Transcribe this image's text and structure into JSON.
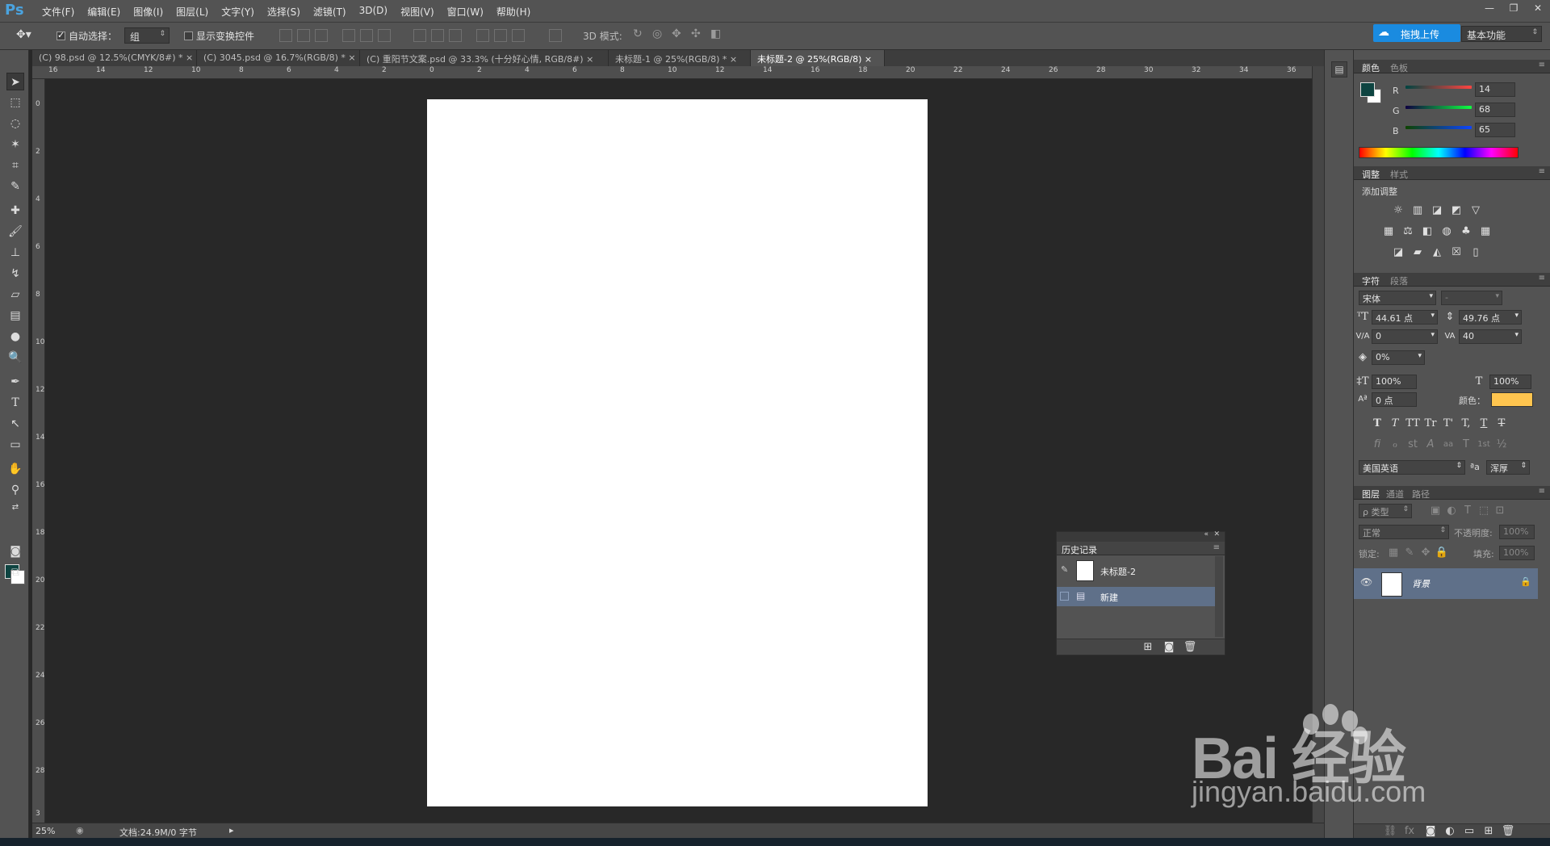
{
  "app": {
    "logo": "Ps"
  },
  "menu": [
    "文件(F)",
    "编辑(E)",
    "图像(I)",
    "图层(L)",
    "文字(Y)",
    "选择(S)",
    "滤镜(T)",
    "3D(D)",
    "视图(V)",
    "窗口(W)",
    "帮助(H)"
  ],
  "window_controls": [
    "—",
    "❐",
    "✕"
  ],
  "options": {
    "auto_select_label": "自动选择：",
    "auto_select_value": "组",
    "show_transform_label": "显示变换控件",
    "mode_3d_label": "3D 模式:",
    "upload_label": "拖拽上传",
    "workspace": "基本功能"
  },
  "doc_tabs": [
    {
      "label": "(C) 98.psd @ 12.5%(CMYK/8#) *",
      "close": "×"
    },
    {
      "label": "(C) 3045.psd @ 16.7%(RGB/8) *",
      "close": "×"
    },
    {
      "label": "(C) 重阳节文案.psd @ 33.3% (十分好心情, RGB/8#)",
      "close": "×"
    },
    {
      "label": "未标题-1 @ 25%(RGB/8) *",
      "close": "×"
    },
    {
      "label": "未标题-2 @ 25%(RGB/8)",
      "close": "×"
    }
  ],
  "ruler_h": [
    "16",
    "14",
    "12",
    "10",
    "8",
    "6",
    "4",
    "2",
    "0",
    "2",
    "4",
    "6",
    "8",
    "10",
    "12",
    "14",
    "16",
    "18",
    "20",
    "22",
    "24",
    "26",
    "28",
    "30",
    "32",
    "34",
    "36"
  ],
  "ruler_v": [
    "0",
    "2",
    "4",
    "6",
    "8",
    "10",
    "12",
    "14",
    "16",
    "18",
    "20",
    "22",
    "24",
    "26",
    "28",
    "3"
  ],
  "status": {
    "zoom": "25%",
    "doc_info": "文档:24.9M/0 字节"
  },
  "color_panel": {
    "tabs": [
      "颜色",
      "色板"
    ],
    "r_label": "R",
    "g_label": "G",
    "b_label": "B",
    "r": "14",
    "g": "68",
    "b": "65",
    "fg": "#0e4441",
    "bg": "#ffffff"
  },
  "adjust_panel": {
    "tabs": [
      "调整",
      "样式"
    ],
    "title": "添加调整"
  },
  "char_panel": {
    "tabs": [
      "字符",
      "段落"
    ],
    "font": "宋体",
    "style": "-",
    "size": "44.61 点",
    "leading": "49.76 点",
    "kerning": "0",
    "tracking": "40",
    "tsume": "0%",
    "v_scale": "100%",
    "h_scale": "100%",
    "baseline": "0 点",
    "color_label": "颜色：",
    "color": "#ffc54f",
    "language": "美国英语",
    "aa_label": "ªa",
    "antialias": "浑厚",
    "style_buttons": [
      "T",
      "T",
      "TT",
      "Tr",
      "T'",
      "T,",
      "T",
      "T"
    ],
    "ot_buttons": [
      "fi",
      "ℴ",
      "st",
      "A",
      "aa",
      "T",
      "1st",
      "½"
    ]
  },
  "layers_panel": {
    "tabs": [
      "图层",
      "通道",
      "路径"
    ],
    "filter": "ρ 类型",
    "blend": "正常",
    "opacity_label": "不透明度:",
    "opacity": "100%",
    "lock_label": "锁定:",
    "fill_label": "填充:",
    "fill": "100%",
    "layer_name": "背景"
  },
  "history_panel": {
    "title": "历史记录",
    "snapshot": "未标题-2",
    "step": "新建"
  },
  "watermark": {
    "brand": "Bai  经验",
    "url": "jingyan.baidu.com"
  }
}
